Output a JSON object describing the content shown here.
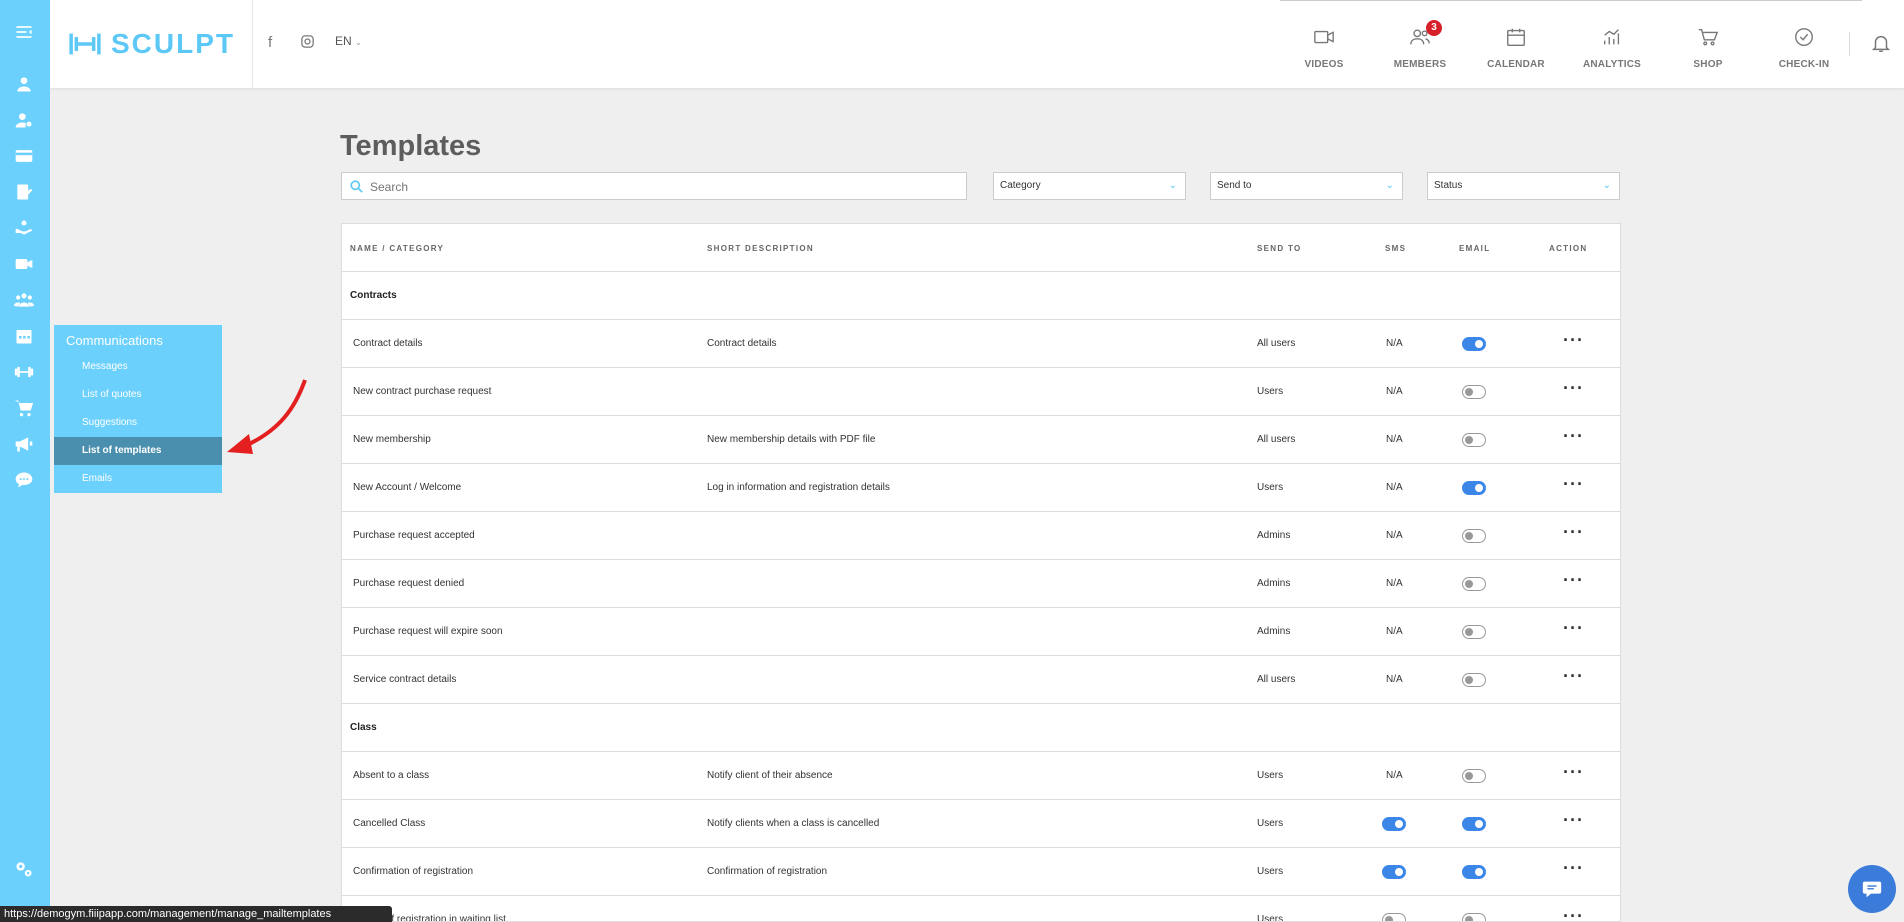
{
  "brand": {
    "name": "SCULPT",
    "accent": "#6cd0fc",
    "toggle_on": "#3b86e8"
  },
  "header": {
    "language": "EN",
    "nav": [
      {
        "label": "VIDEOS",
        "icon": "video-icon"
      },
      {
        "label": "MEMBERS",
        "icon": "members-icon",
        "badge": "3"
      },
      {
        "label": "CALENDAR",
        "icon": "calendar-icon"
      },
      {
        "label": "ANALYTICS",
        "icon": "analytics-icon"
      },
      {
        "label": "SHOP",
        "icon": "cart-icon"
      },
      {
        "label": "CHECK-IN",
        "icon": "check-circle-icon"
      }
    ]
  },
  "flyout": {
    "title": "Communications",
    "items": [
      "Messages",
      "List of quotes",
      "Suggestions",
      "List of templates",
      "Emails"
    ],
    "active": "List of templates"
  },
  "page": {
    "title": "Templates",
    "search_placeholder": "Search",
    "filters": [
      "Category",
      "Send to",
      "Status"
    ]
  },
  "table": {
    "headers": [
      "NAME / CATEGORY",
      "SHORT DESCRIPTION",
      "SEND TO",
      "SMS",
      "EMAIL",
      "ACTION"
    ],
    "groups": [
      {
        "name": "Contracts",
        "rows": [
          {
            "name": "Contract details",
            "desc": "Contract details",
            "send_to": "All users",
            "sms": "N/A",
            "email": true
          },
          {
            "name": "New contract purchase request",
            "desc": "",
            "send_to": "Users",
            "sms": "N/A",
            "email": false
          },
          {
            "name": "New membership",
            "desc": "New membership details with PDF file",
            "send_to": "All users",
            "sms": "N/A",
            "email": false
          },
          {
            "name": "New Account / Welcome",
            "desc": "Log in information and registration details",
            "send_to": "Users",
            "sms": "N/A",
            "email": true
          },
          {
            "name": "Purchase request accepted",
            "desc": "",
            "send_to": "Admins",
            "sms": "N/A",
            "email": false
          },
          {
            "name": "Purchase request denied",
            "desc": "",
            "send_to": "Admins",
            "sms": "N/A",
            "email": false
          },
          {
            "name": "Purchase request will expire soon",
            "desc": "",
            "send_to": "Admins",
            "sms": "N/A",
            "email": false
          },
          {
            "name": "Service contract details",
            "desc": "",
            "send_to": "All users",
            "sms": "N/A",
            "email": false
          }
        ]
      },
      {
        "name": "Class",
        "rows": [
          {
            "name": "Absent to a class",
            "desc": "Notify client of their absence",
            "send_to": "Users",
            "sms": "N/A",
            "email": false
          },
          {
            "name": "Cancelled Class",
            "desc": "Notify clients when a class is cancelled",
            "send_to": "Users",
            "sms": true,
            "email": true
          },
          {
            "name": "Confirmation of registration",
            "desc": "Confirmation of registration",
            "send_to": "Users",
            "sms": true,
            "email": true
          },
          {
            "name": "...ation of registration in waiting list",
            "desc": "",
            "send_to": "Users",
            "sms": false,
            "email": false
          }
        ]
      }
    ]
  },
  "status_bar": "https://demogym.fiiipapp.com/management/manage_mailtemplates"
}
